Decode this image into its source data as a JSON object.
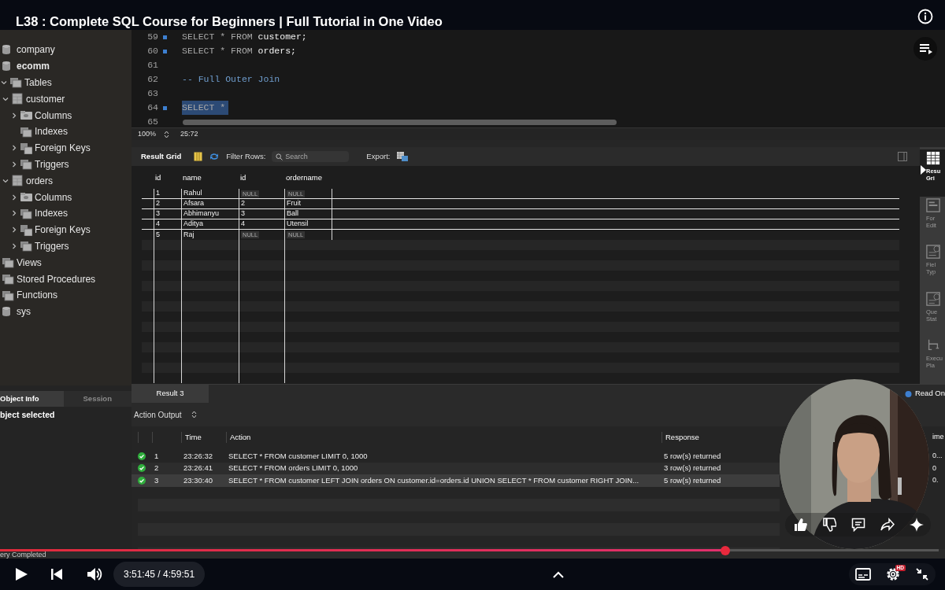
{
  "player": {
    "title": "L38 : Complete SQL Course for Beginners | Full Tutorial in One Video",
    "progress": {
      "level": 0.773
    },
    "playing": false,
    "time": "3:51:45 / 4:59:51",
    "quality_badge": "HD"
  },
  "navigator": {
    "tree": [
      {
        "kind": "schema",
        "label": "company",
        "default_schema": false
      },
      {
        "kind": "schema",
        "label": "ecomm",
        "default_schema": true
      },
      {
        "kind": "group",
        "label": "Tables",
        "expanded": true,
        "children": [
          {
            "kind": "table",
            "label": "customer",
            "expanded": true,
            "children": [
              {
                "kind": "columns",
                "label": "Columns",
                "expanded": false
              },
              {
                "kind": "group",
                "label": "Indexes"
              },
              {
                "kind": "keys",
                "label": "Foreign Keys",
                "expanded": false
              },
              {
                "kind": "group",
                "label": "Triggers",
                "expanded": false
              }
            ]
          },
          {
            "kind": "table",
            "label": "orders",
            "expanded": true,
            "children": [
              {
                "kind": "columns",
                "label": "Columns",
                "expanded": false
              },
              {
                "kind": "group",
                "label": "Indexes",
                "expanded": false
              },
              {
                "kind": "keys",
                "label": "Foreign Keys",
                "expanded": false
              },
              {
                "kind": "group",
                "label": "Triggers",
                "expanded": false
              }
            ]
          }
        ]
      },
      {
        "kind": "group",
        "label": "Views"
      },
      {
        "kind": "group",
        "label": "Stored Procedures"
      },
      {
        "kind": "group",
        "label": "Functions"
      },
      {
        "kind": "schema",
        "label": "sys",
        "default_schema": false
      }
    ],
    "info_tabs": [
      {
        "label": "Object Info",
        "selected": true
      },
      {
        "label": "Session",
        "selected": false
      }
    ],
    "info_text": "bject selected"
  },
  "editor": {
    "lines": [
      {
        "number": "59",
        "marker": true,
        "selected": false,
        "kind": "code",
        "tokens": [
          {
            "kind": "keyword",
            "text": "SELECT * FROM"
          },
          {
            "kind": "name",
            "text": "customer;"
          }
        ]
      },
      {
        "number": "60",
        "marker": true,
        "selected": false,
        "kind": "code",
        "tokens": [
          {
            "kind": "keyword",
            "text": "SELECT * FROM"
          },
          {
            "kind": "name",
            "text": "orders;"
          }
        ]
      },
      {
        "number": "61",
        "marker": false,
        "selected": false,
        "kind": "blank"
      },
      {
        "number": "62",
        "marker": false,
        "selected": false,
        "kind": "comment",
        "tokens": [
          {
            "kind": "comment",
            "text": "-- Full Outer Join"
          }
        ]
      },
      {
        "number": "63",
        "marker": false,
        "selected": false,
        "kind": "blank"
      },
      {
        "number": "64",
        "marker": true,
        "selected": true,
        "kind": "code",
        "tokens": [
          {
            "kind": "keyword",
            "text": "SELECT *"
          }
        ]
      },
      {
        "number": "65",
        "marker": false,
        "selected": false,
        "kind": "blank"
      }
    ],
    "zoom": "100%",
    "cursor": "25:72"
  },
  "result_toolbar": {
    "title": "Result Grid",
    "filter_label": "Filter Rows:",
    "search": {
      "placeholder": "Search"
    },
    "export_label": "Export:"
  },
  "result_grid": {
    "columns": [
      "id",
      "name",
      "id",
      "ordername"
    ],
    "rows": [
      {
        "cells": [
          {
            "text": "1",
            "null": false
          },
          {
            "text": "Rahul",
            "null": false
          },
          {
            "text": "NULL",
            "null": true
          },
          {
            "text": "NULL",
            "null": true
          }
        ]
      },
      {
        "cells": [
          {
            "text": "2",
            "null": false
          },
          {
            "text": "Afsara",
            "null": false
          },
          {
            "text": "2",
            "null": false
          },
          {
            "text": "Fruit",
            "null": false
          }
        ]
      },
      {
        "cells": [
          {
            "text": "3",
            "null": false
          },
          {
            "text": "Abhimanyu",
            "null": false
          },
          {
            "text": "3",
            "null": false
          },
          {
            "text": "Ball",
            "null": false
          }
        ]
      },
      {
        "cells": [
          {
            "text": "4",
            "null": false
          },
          {
            "text": "Aditya",
            "null": false
          },
          {
            "text": "4",
            "null": false
          },
          {
            "text": "Utensil",
            "null": false
          }
        ]
      },
      {
        "cells": [
          {
            "text": "5",
            "null": false
          },
          {
            "text": "Raj",
            "null": false
          },
          {
            "text": "NULL",
            "null": true
          },
          {
            "text": "NULL",
            "null": true
          }
        ]
      }
    ]
  },
  "side_tabs": [
    {
      "lines": [
        "Resu",
        "Gri"
      ],
      "selected": true
    },
    {
      "lines": [
        "For",
        "Edit"
      ],
      "selected": false
    },
    {
      "lines": [
        "Fiel",
        "Typ"
      ],
      "selected": false
    },
    {
      "lines": [
        "Que",
        "Stat"
      ],
      "selected": false
    },
    {
      "lines": [
        "Execu",
        "Pla"
      ],
      "selected": false
    }
  ],
  "result_tabs": [
    {
      "label": "Result 3",
      "selected": true
    }
  ],
  "read_only": "Read On",
  "output": {
    "selector": "Action Output",
    "columns": [
      "Time",
      "Action",
      "Response",
      "ime"
    ],
    "rows": [
      {
        "kind": "success",
        "number": "1",
        "time": "23:26:32",
        "action": "SELECT * FROM customer LIMIT 0, 1000",
        "response": "5 row(s) returned",
        "column_5": "0...",
        "selected": false
      },
      {
        "kind": "success",
        "number": "2",
        "time": "23:26:41",
        "action": "SELECT * FROM orders LIMIT 0, 1000",
        "response": "3 row(s) returned",
        "column_5": "0",
        "selected": false
      },
      {
        "kind": "success",
        "number": "3",
        "time": "23:30:40",
        "action": "SELECT * FROM customer LEFT JOIN orders ON customer.id=orders.id UNION SELECT * FROM customer RIGHT JOIN...",
        "response": "5 row(s) returned",
        "column_5": "0.",
        "selected": true
      }
    ]
  },
  "status_text": "ery Completed"
}
